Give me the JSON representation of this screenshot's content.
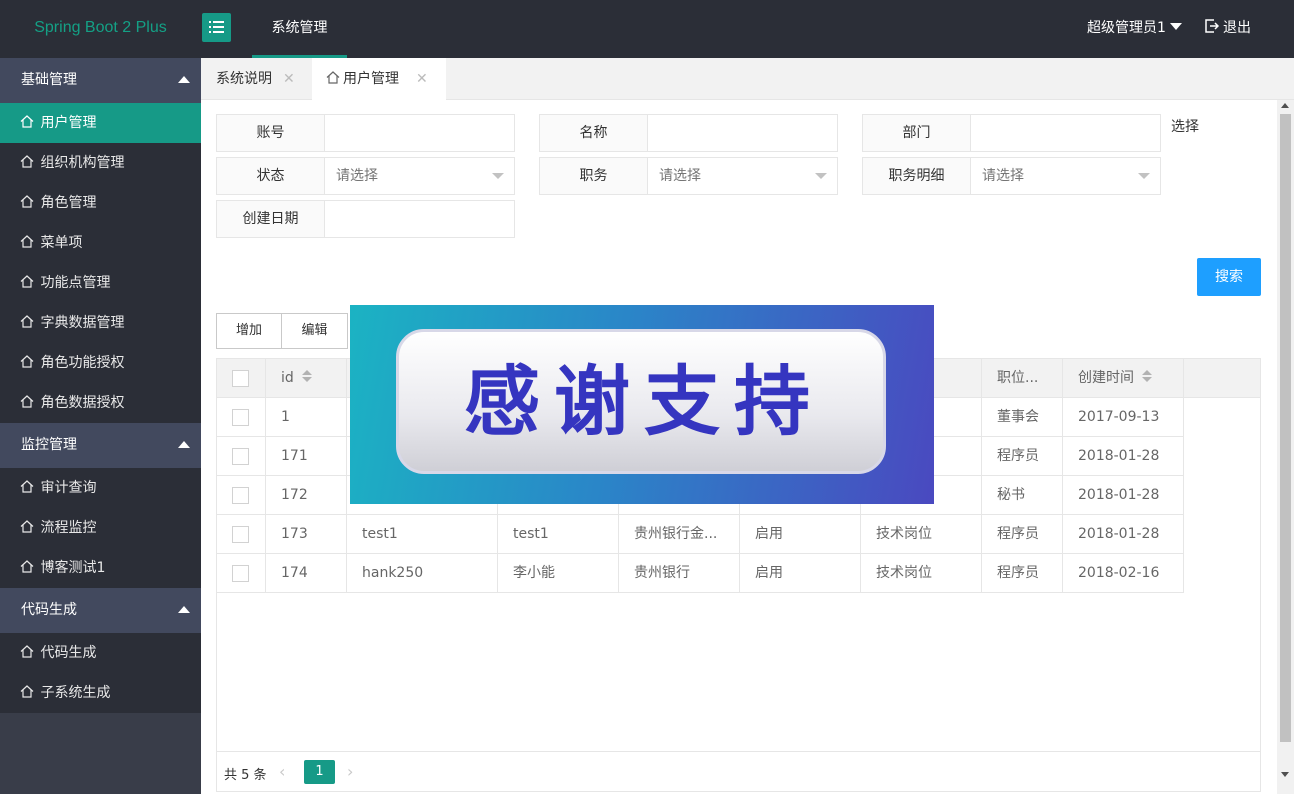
{
  "app": {
    "brand": "Spring Boot 2 Plus",
    "top_nav": "系统管理",
    "user": "超级管理员1",
    "logout": "退出"
  },
  "sidebar": {
    "groups": [
      {
        "label": "基础管理",
        "items": [
          "用户管理",
          "组织机构管理",
          "角色管理",
          "菜单项",
          "功能点管理",
          "字典数据管理",
          "角色功能授权",
          "角色数据授权"
        ]
      },
      {
        "label": "监控管理",
        "items": [
          "审计查询",
          "流程监控",
          "博客测试1"
        ]
      },
      {
        "label": "代码生成",
        "items": [
          "代码生成",
          "子系统生成"
        ]
      }
    ],
    "active_item": "用户管理"
  },
  "tabs": [
    {
      "label": "系统说明",
      "active": false
    },
    {
      "label": "用户管理",
      "active": true
    }
  ],
  "search_form": {
    "account_label": "账号",
    "name_label": "名称",
    "dept_label": "部门",
    "dept_select_text": "选择",
    "status_label": "状态",
    "status_placeholder": "请选择",
    "job_label": "职务",
    "job_placeholder": "请选择",
    "job_detail_label": "职务明细",
    "job_detail_placeholder": "请选择",
    "create_date_label": "创建日期",
    "search_button": "搜索"
  },
  "toolbar": {
    "add": "增加",
    "edit": "编辑"
  },
  "table": {
    "headers": [
      "id",
      "",
      "",
      "",
      "",
      "",
      "职位...",
      "创建时间"
    ],
    "rows": [
      [
        "1",
        "",
        "",
        "",
        "",
        "",
        "董事会",
        "2017-09-13"
      ],
      [
        "171",
        "",
        "",
        "",
        "",
        "",
        "程序员",
        "2018-01-28"
      ],
      [
        "172",
        "",
        "",
        "",
        "",
        "",
        "秘书",
        "2018-01-28"
      ],
      [
        "173",
        "test1",
        "test1",
        "贵州银行金...",
        "启用",
        "技术岗位",
        "程序员",
        "2018-01-28"
      ],
      [
        "174",
        "hank250",
        "李小能",
        "贵州银行",
        "启用",
        "技术岗位",
        "程序员",
        "2018-02-16"
      ]
    ]
  },
  "pager": {
    "total": "共 5 条",
    "current": "1"
  },
  "banner": {
    "text": "感谢支持"
  }
}
